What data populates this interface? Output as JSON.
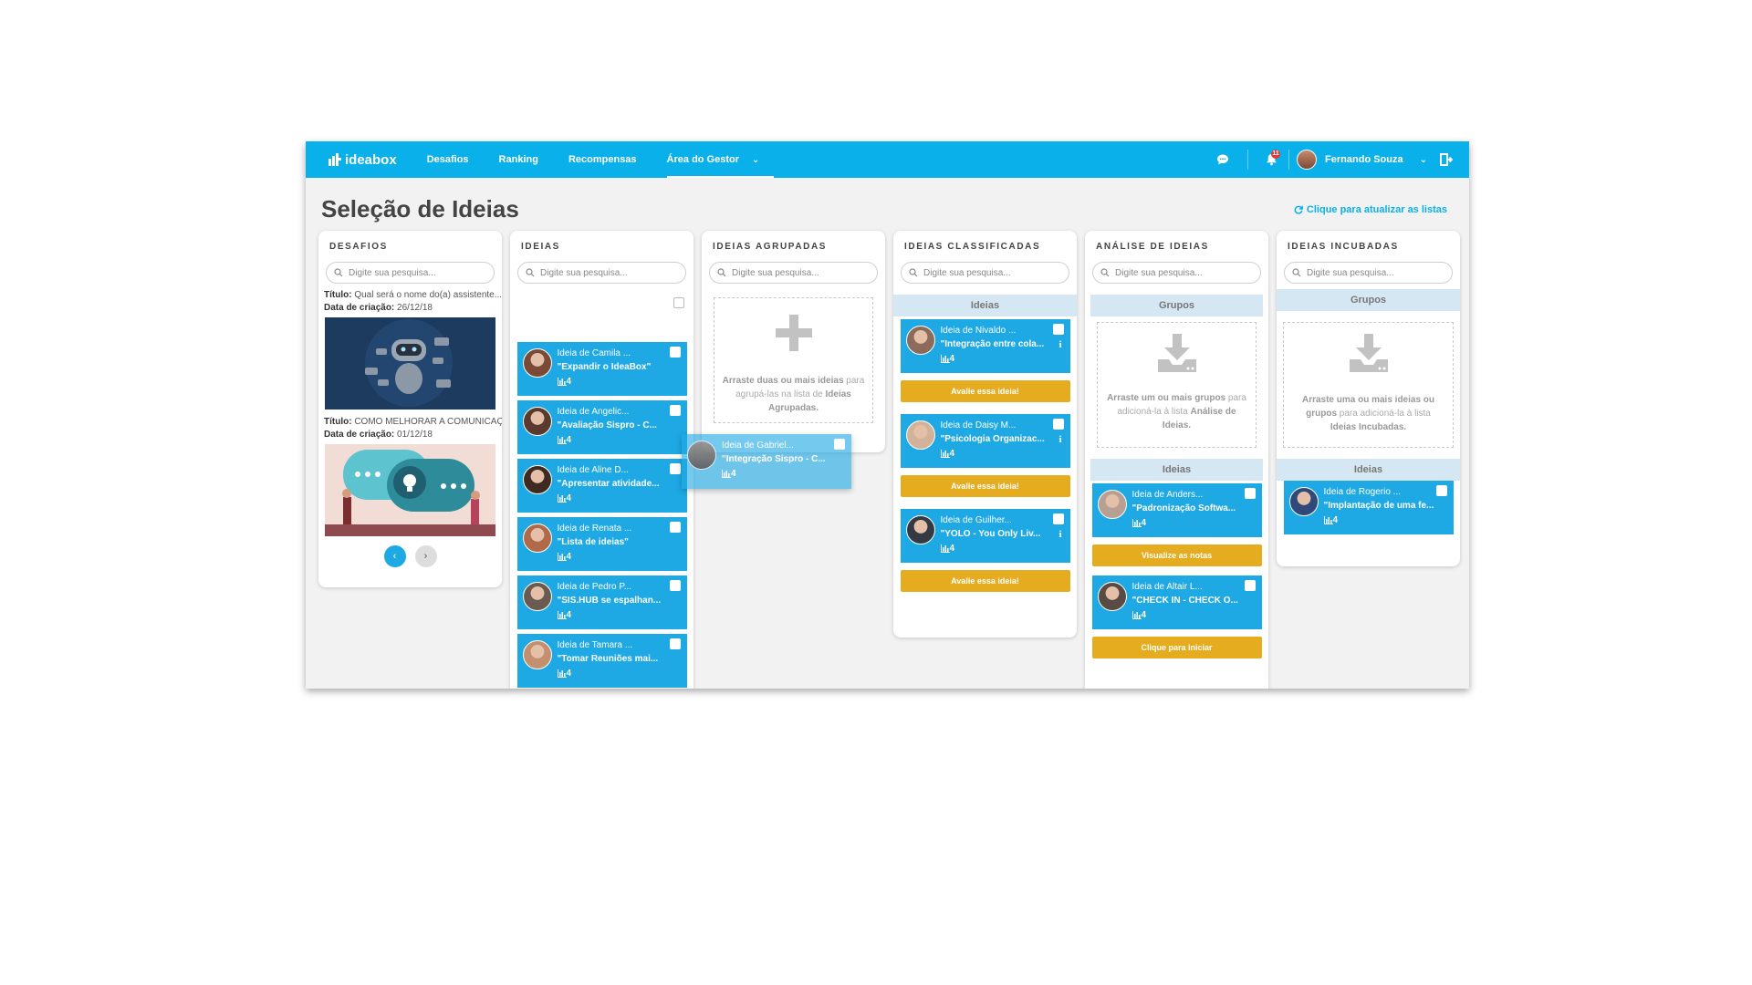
{
  "nav": {
    "brand": "ideabox",
    "links": [
      "Desafios",
      "Ranking",
      "Recompensas",
      "Área do Gestor"
    ],
    "notification_count": "11",
    "user_name": "Fernando Souza"
  },
  "page": {
    "title": "Seleção de Ideias",
    "refresh": "Clique para atualizar as listas"
  },
  "search_placeholder": "Digite sua pesquisa...",
  "colors": {
    "accent": "#0ab0ea",
    "card": "#1ea8e4",
    "action": "#e6ac1f",
    "section": "#d6e7f4"
  },
  "columns": {
    "desafios": {
      "title": "DESAFIOS",
      "items": [
        {
          "title_label": "Título:",
          "title": "Qual será o nome do(a) assistente...",
          "date_label": "Data de criação:",
          "date": "26/12/18"
        },
        {
          "title_label": "Título:",
          "title": "COMO MELHORAR A COMUNICAÇÃO",
          "date_label": "Data de criação:",
          "date": "01/12/18"
        }
      ]
    },
    "ideias": {
      "title": "IDEIAS",
      "cards": [
        {
          "author": "Ideia de Camila ...",
          "name": "\"Expandir o IdeaBox\"",
          "score": "4"
        },
        {
          "author": "Ideia de Angelic...",
          "name": "\"Avaliação Sispro - C...",
          "score": "4"
        },
        {
          "author": "Ideia de Aline D...",
          "name": "\"Apresentar atividade...",
          "score": "4"
        },
        {
          "author": "Ideia de Renata ...",
          "name": "\"Lista de ideias\"",
          "score": "4"
        },
        {
          "author": "Ideia de Pedro P...",
          "name": "\"SIS.HUB se espalhan...",
          "score": "4"
        },
        {
          "author": "Ideia de Tamara ...",
          "name": "\"Tomar Reuniões mai...",
          "score": "4"
        }
      ]
    },
    "agrupadas": {
      "title": "IDEIAS AGRUPADAS",
      "drop_text_1": "Arraste duas ou mais ideias",
      "drop_text_2": " para agrupá-las na lista de ",
      "drop_text_3": "Ideias Agrupadas."
    },
    "classificadas": {
      "title": "IDEIAS CLASSIFICADAS",
      "section": "Ideias",
      "cards": [
        {
          "author": "Ideia de Nivaldo ...",
          "name": "\"Integração entre cola...",
          "score": "4",
          "action": "Avalie essa ideia!"
        },
        {
          "author": "Ideia de Daisy M...",
          "name": "\"Psicologia Organizac...",
          "score": "4",
          "action": "Avalie essa ideia!"
        },
        {
          "author": "Ideia de Guilher...",
          "name": "\"YOLO - You Only Liv...",
          "score": "4",
          "action": "Avalie essa ideia!"
        }
      ]
    },
    "analise": {
      "title": "ANÁLISE DE IDEIAS",
      "groups_section": "Grupos",
      "drop_text_1": "Arraste um ou mais grupos",
      "drop_text_2": " para adicioná-la à lista ",
      "drop_text_3": "Análise de Ideias.",
      "ideas_section": "Ideias",
      "cards": [
        {
          "author": "Ideia de Anders...",
          "name": "\"Padronização Softwa...",
          "score": "4",
          "action": "Visualize as notas"
        },
        {
          "author": "Ideia de Altair L...",
          "name": "\"CHECK IN - CHECK O...",
          "score": "4",
          "action": "Clique para iniciar"
        }
      ]
    },
    "incubadas": {
      "title": "IDEIAS INCUBADAS",
      "groups_section": "Grupos",
      "drop_text_1": "Arraste uma ou mais ideias ou grupos",
      "drop_text_2": " para adicioná-la à lista ",
      "drop_text_3": "Ideias Incubadas.",
      "ideas_section": "Ideias",
      "cards": [
        {
          "author": "Ideia de Rogerio ...",
          "name": "\"Implantação de uma fe...",
          "score": "4"
        }
      ]
    }
  },
  "dragging_card": {
    "author": "Ideia de Gabriel...",
    "name": "\"Integração Sispro - C...",
    "score": "4"
  }
}
